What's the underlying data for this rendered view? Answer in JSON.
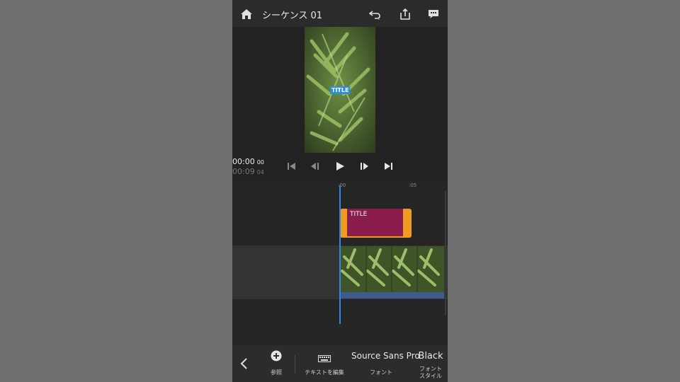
{
  "header": {
    "title": "シーケンス 01",
    "home_icon": "home-icon",
    "undo_icon": "undo-icon",
    "share_icon": "share-icon",
    "feedback_icon": "feedback-icon"
  },
  "preview": {
    "title_overlay": "TITLE",
    "current_timecode": "00:00",
    "current_frames": "00",
    "duration_timecode": "00:09",
    "duration_frames": "04"
  },
  "transport": [
    "skip-to-start-icon",
    "step-back-icon",
    "play-icon",
    "step-forward-icon",
    "skip-to-end-icon"
  ],
  "timeline": {
    "ruler": [
      ":00",
      ":05"
    ],
    "title_clip_label": "TITLE"
  },
  "toolbar": {
    "browse_label": "参照",
    "edit_text_label": "テキストを編集",
    "font_value": "Source Sans Pro",
    "font_label": "フォント",
    "font_style_value": "Black",
    "font_style_label": "フォント\nスタイル"
  },
  "colors": {
    "accent": "#2f86e3",
    "title_clip_border": "#f19a22",
    "title_clip_fill": "#8b1d4d",
    "clip_bar": "#3e5a8f"
  }
}
